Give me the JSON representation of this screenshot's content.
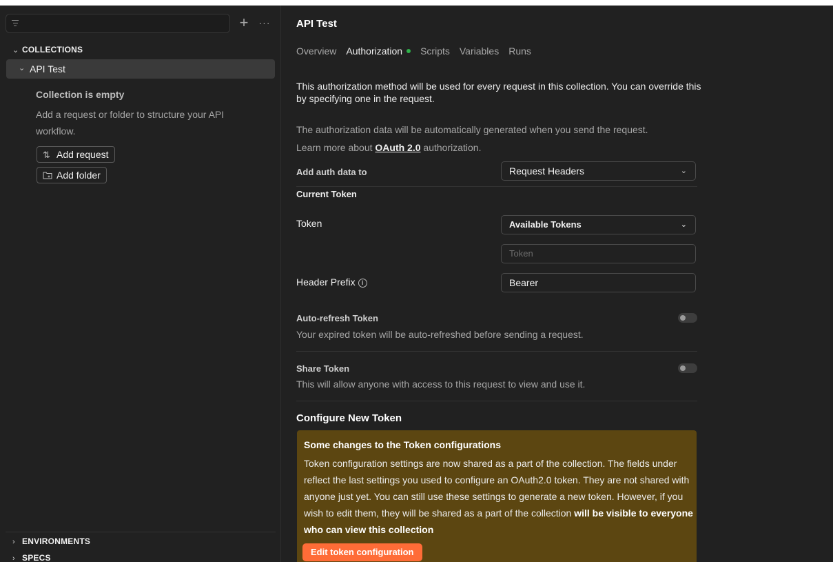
{
  "sidebar": {
    "sections": {
      "collections": "COLLECTIONS",
      "environments": "ENVIRONMENTS",
      "specs": "SPECS"
    },
    "collection_name": "API Test",
    "empty_title": "Collection is empty",
    "empty_desc": "Add a request or folder to structure your API workflow.",
    "add_request": "Add request",
    "add_folder": "Add folder",
    "plus": "+",
    "more": "···"
  },
  "main": {
    "title": "API Test",
    "tabs": [
      {
        "label": "Overview"
      },
      {
        "label": "Authorization",
        "active": true
      },
      {
        "label": "Scripts"
      },
      {
        "label": "Variables"
      },
      {
        "label": "Runs"
      }
    ],
    "intro": "This authorization method will be used for every request in this collection. You can override this by specifying one in the request.",
    "auto_gen": "The authorization data will be automatically generated when you send the request.",
    "learn_prefix": "Learn more about ",
    "learn_link": "OAuth 2.0",
    "learn_suffix": " authorization.",
    "add_auth_label": "Add auth data to",
    "add_auth_value": "Request Headers",
    "current_token": "Current Token",
    "token_label": "Token",
    "token_select": "Available Tokens",
    "token_placeholder": "Token",
    "header_prefix_label": "Header Prefix",
    "header_prefix_value": "Bearer",
    "auto_refresh_title": "Auto-refresh Token",
    "auto_refresh_desc": "Your expired token will be auto-refreshed before sending a request.",
    "share_title": "Share Token",
    "share_desc": "This will allow anyone with access to this request to view and use it.",
    "configure_title": "Configure New Token",
    "warning": {
      "title": "Some changes to the Token configurations",
      "text": "Token configuration settings are now shared as a part of the collection. The fields under reflect the last settings you used to configure an OAuth2.0 token. They are not shared with anyone just yet. You can still use these settings to generate a new token. However, if you wish to edit them, they will be shared as a part of the collection ",
      "text_bold": "will be visible to everyone who can view this collection",
      "button": "Edit token configuration"
    }
  },
  "colors": {
    "background": "#212121",
    "accent": "#ff6c37",
    "warning_bg": "#5c4611",
    "active_dot": "#2fb34a"
  }
}
